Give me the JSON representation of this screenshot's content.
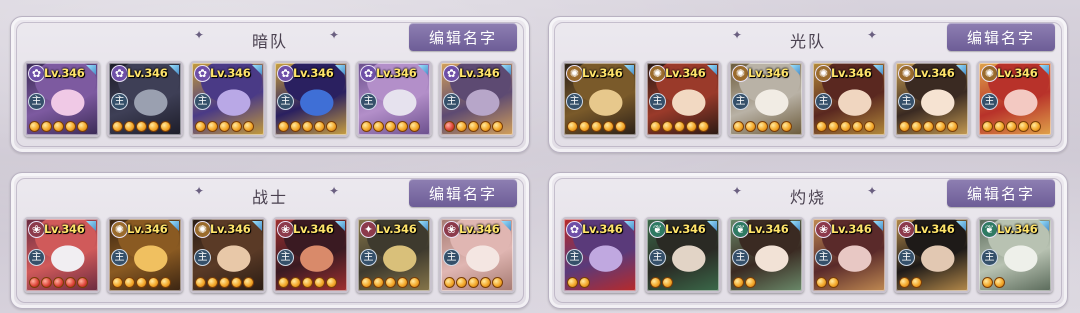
{
  "level_text": "Lv.346",
  "edit_label": "编辑名字",
  "teams": [
    {
      "name": "暗队",
      "members": [
        {
          "element_icon": "dark-lotus-icon",
          "element": "dark",
          "stars": 5,
          "red_stars": 0,
          "palette": [
            "#f0c9e6",
            "#7d5aa0",
            "#3a2a55"
          ]
        },
        {
          "element_icon": "dark-lotus-icon",
          "element": "dark",
          "stars": 5,
          "red_stars": 0,
          "palette": [
            "#9aa0b0",
            "#3e3f56",
            "#1c1c28"
          ]
        },
        {
          "element_icon": "dark-lotus-icon",
          "element": "dark",
          "stars": 5,
          "red_stars": 0,
          "palette": [
            "#b9a8e6",
            "#4a3a86",
            "#c49b3a"
          ]
        },
        {
          "element_icon": "dark-lotus-icon",
          "element": "dark",
          "stars": 5,
          "red_stars": 0,
          "palette": [
            "#3f6fd6",
            "#2a2060",
            "#c9a040"
          ]
        },
        {
          "element_icon": "dark-lotus-icon",
          "element": "dark",
          "stars": 5,
          "red_stars": 0,
          "palette": [
            "#e6e2ee",
            "#b38fc9",
            "#6b4f8d"
          ]
        },
        {
          "element_icon": "dark-lotus-icon",
          "element": "dark",
          "stars": 5,
          "red_stars": 1,
          "palette": [
            "#b7a6c9",
            "#5d4a72",
            "#d3a05a"
          ]
        }
      ]
    },
    {
      "name": "光队",
      "members": [
        {
          "element_icon": "light-sun-icon",
          "element": "light",
          "stars": 5,
          "red_stars": 0,
          "palette": [
            "#e7c88c",
            "#7a5a2a",
            "#2b2018"
          ]
        },
        {
          "element_icon": "light-sun-icon",
          "element": "light",
          "stars": 5,
          "red_stars": 0,
          "palette": [
            "#f2d9c2",
            "#9a3a2a",
            "#2a1a14"
          ]
        },
        {
          "element_icon": "light-sun-icon",
          "element": "light",
          "stars": 5,
          "red_stars": 0,
          "palette": [
            "#f1ece4",
            "#b9b2a6",
            "#6b5a3a"
          ]
        },
        {
          "element_icon": "light-sun-icon",
          "element": "light",
          "stars": 5,
          "red_stars": 0,
          "palette": [
            "#f0d6c0",
            "#5a2820",
            "#b48a3a"
          ]
        },
        {
          "element_icon": "light-sun-icon",
          "element": "light",
          "stars": 5,
          "red_stars": 0,
          "palette": [
            "#f6e3d2",
            "#3a2a22",
            "#c59b52"
          ]
        },
        {
          "element_icon": "light-sun-icon",
          "element": "light",
          "stars": 5,
          "red_stars": 0,
          "palette": [
            "#f3c9c2",
            "#b8322a",
            "#e0a34a"
          ]
        }
      ]
    },
    {
      "name": "战士",
      "members": [
        {
          "element_icon": "fire-lotus-icon",
          "element": "fire",
          "stars": 5,
          "red_stars": 5,
          "palette": [
            "#f1eef2",
            "#d05a5a",
            "#6a2a40"
          ]
        },
        {
          "element_icon": "light-sun-icon",
          "element": "light",
          "stars": 5,
          "red_stars": 0,
          "palette": [
            "#f0c060",
            "#8a5a22",
            "#3a2412"
          ]
        },
        {
          "element_icon": "light-sun-icon",
          "element": "light",
          "stars": 5,
          "red_stars": 0,
          "palette": [
            "#e8c8a8",
            "#5a3a26",
            "#2a1c14"
          ]
        },
        {
          "element_icon": "fire-lotus-icon",
          "element": "fire",
          "stars": 5,
          "red_stars": 0,
          "palette": [
            "#d98a6a",
            "#3a1a22",
            "#a03030"
          ]
        },
        {
          "element_icon": "fire-flame-icon",
          "element": "fire",
          "stars": 5,
          "red_stars": 0,
          "palette": [
            "#d9c07a",
            "#3e3a2e",
            "#87764a"
          ]
        },
        {
          "element_icon": "fire-lotus-icon",
          "element": "fire",
          "stars": 5,
          "red_stars": 0,
          "palette": [
            "#f4e6e2",
            "#e0b6b2",
            "#a57a72"
          ]
        }
      ]
    },
    {
      "name": "灼烧",
      "members": [
        {
          "element_icon": "dark-lotus-icon",
          "element": "dark",
          "stars": 2,
          "red_stars": 0,
          "palette": [
            "#c0a8e0",
            "#5a3a7a",
            "#b82a2a"
          ]
        },
        {
          "element_icon": "wind-leaf-icon",
          "element": "wind",
          "stars": 2,
          "red_stars": 0,
          "palette": [
            "#e2d4c6",
            "#2a2a24",
            "#3b6a4a"
          ]
        },
        {
          "element_icon": "wind-leaf-icon",
          "element": "wind",
          "stars": 2,
          "red_stars": 0,
          "palette": [
            "#f2e2d6",
            "#3a2a22",
            "#6a8a6a"
          ]
        },
        {
          "element_icon": "fire-lotus-icon",
          "element": "fire",
          "stars": 2,
          "red_stars": 0,
          "palette": [
            "#e8c8c4",
            "#5a2a2a",
            "#c08a52"
          ]
        },
        {
          "element_icon": "fire-lotus-icon",
          "element": "fire",
          "stars": 2,
          "red_stars": 0,
          "palette": [
            "#e2c8b2",
            "#1e1a18",
            "#b58a4a"
          ]
        },
        {
          "element_icon": "wind-leaf-icon",
          "element": "wind",
          "stars": 2,
          "red_stars": 0,
          "palette": [
            "#eef0ea",
            "#b8c2b2",
            "#5a6a5a"
          ]
        }
      ]
    }
  ],
  "icons": {
    "class": "shikigami-class-icon",
    "header_decoration": "diamond-sparkle-icon"
  }
}
